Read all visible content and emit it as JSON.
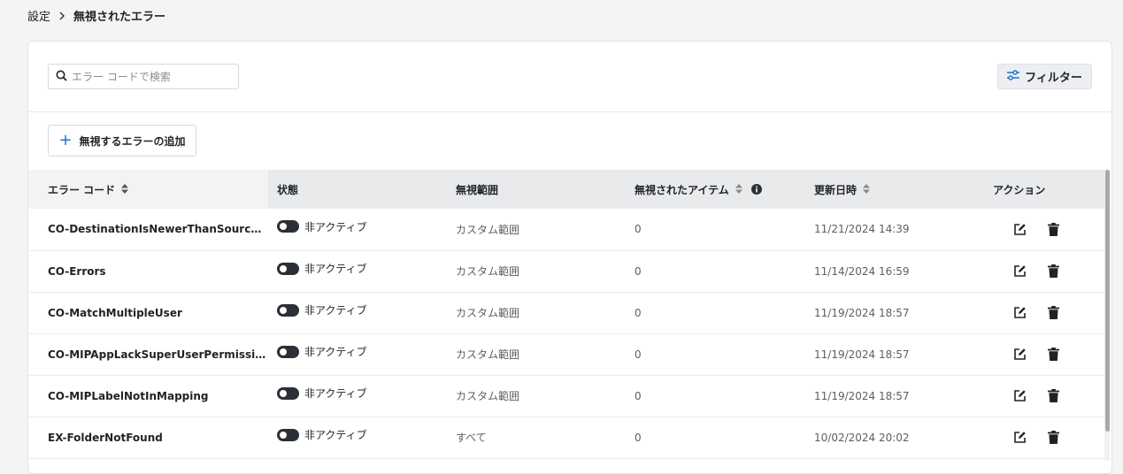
{
  "breadcrumb": {
    "root": "設定",
    "current": "無視されたエラー"
  },
  "toolbar": {
    "search_placeholder": "エラー コードで検索",
    "filter_label": "フィルター",
    "add_label": "無視するエラーの追加"
  },
  "table": {
    "columns": {
      "code": "エラー コード",
      "status": "状態",
      "scope": "無視範囲",
      "items": "無視されたアイテム",
      "updated": "更新日時",
      "actions": "アクション"
    },
    "rows": [
      {
        "code": "CO-DestinationIsNewerThanSourceWa...",
        "status": "非アクティブ",
        "scope": "カスタム範囲",
        "items": "0",
        "updated": "11/21/2024 14:39"
      },
      {
        "code": "CO-Errors",
        "status": "非アクティブ",
        "scope": "カスタム範囲",
        "items": "0",
        "updated": "11/14/2024 16:59"
      },
      {
        "code": "CO-MatchMultipleUser",
        "status": "非アクティブ",
        "scope": "カスタム範囲",
        "items": "0",
        "updated": "11/19/2024 18:57"
      },
      {
        "code": "CO-MIPAppLackSuperUserPermission",
        "status": "非アクティブ",
        "scope": "カスタム範囲",
        "items": "0",
        "updated": "11/19/2024 18:57"
      },
      {
        "code": "CO-MIPLabelNotInMapping",
        "status": "非アクティブ",
        "scope": "カスタム範囲",
        "items": "0",
        "updated": "11/19/2024 18:57"
      },
      {
        "code": "EX-FolderNotFound",
        "status": "非アクティブ",
        "scope": "すべて",
        "items": "0",
        "updated": "10/02/2024 20:02"
      }
    ]
  },
  "icons": {
    "search": "search-icon",
    "filter": "sliders-icon",
    "add": "plus-icon",
    "sort": "sort-icon",
    "info": "info-icon",
    "edit": "edit-icon",
    "delete": "trash-icon"
  },
  "colors": {
    "accent": "#1a73c9",
    "toggle_off": "#2b2f36",
    "header_bg": "#e9eaec"
  }
}
